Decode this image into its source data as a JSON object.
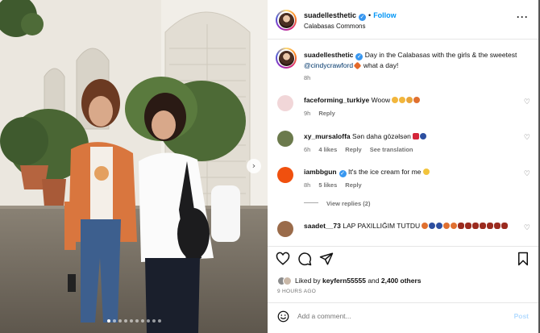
{
  "photo": {
    "carousel_dots": 10,
    "active_dot": 0,
    "next_arrow": "chevron-right-icon"
  },
  "header": {
    "username": "suadellesthetic",
    "separator": "•",
    "follow_label": "Follow",
    "location": "Calabasas Commons",
    "more_icon": "···"
  },
  "caption": {
    "username": "suadellesthetic",
    "text_before": "Day in the Calabasas with the girls & the sweetest",
    "mention": "@cindycrawford",
    "text_after": "what a day!",
    "time": "8h"
  },
  "comments": [
    {
      "username": "faceforming_turkiye",
      "text": "Woow",
      "time": "9h",
      "likes": "",
      "reply": "Reply",
      "extra": ""
    },
    {
      "username": "xy_mursaloffa",
      "text": "Sən daha gözəlsən",
      "time": "6h",
      "likes": "4 likes",
      "reply": "Reply",
      "extra": "See translation"
    },
    {
      "username": "iambbgun",
      "text": "It's the ice cream for me",
      "time": "8h",
      "likes": "5 likes",
      "reply": "Reply",
      "extra": ""
    },
    {
      "username": "saadet__73",
      "text": "LAP PAXILLIĞIM TUTDU",
      "time": "",
      "likes": "",
      "reply": "",
      "extra": ""
    }
  ],
  "view_replies": "View replies (2)",
  "likes": {
    "prefix": "Liked by",
    "user": "keyfern55555",
    "middle": "and",
    "count": "2,400 others"
  },
  "time_ago": "9 HOURS AGO",
  "add_comment": {
    "placeholder": "Add a comment...",
    "post_label": "Post"
  },
  "colors": {
    "accent": "#0095f6",
    "mention": "#00376b",
    "muted": "#737373",
    "post_disabled": "#b3dbff"
  }
}
